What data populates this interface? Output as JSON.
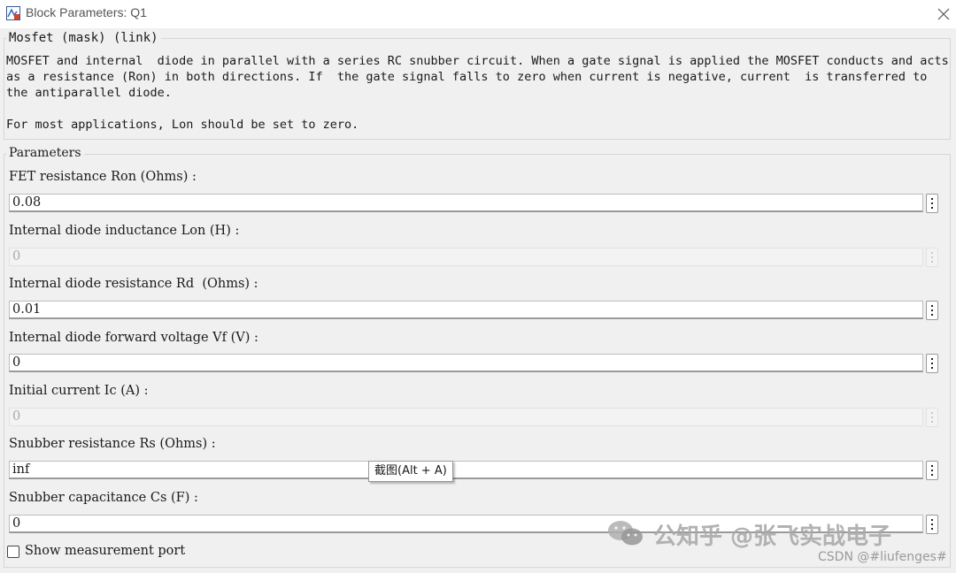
{
  "window": {
    "title": "Block Parameters: Q1"
  },
  "mask": {
    "legend": "Mosfet (mask) (link)",
    "description": "MOSFET and internal  diode in parallel with a series RC snubber circuit. When a gate signal is applied the MOSFET conducts and acts\nas a resistance (Ron) in both directions. If  the gate signal falls to zero when current is negative, current  is transferred to\nthe antiparallel diode.\n\nFor most applications, Lon should be set to zero."
  },
  "parameters": {
    "legend": "Parameters",
    "fields": [
      {
        "label": "FET resistance Ron (Ohms) :",
        "value": "0.08",
        "enabled": true
      },
      {
        "label": "Internal diode inductance Lon (H) :",
        "value": "0",
        "enabled": false
      },
      {
        "label": "Internal diode resistance Rd  (Ohms) :",
        "value": "0.01",
        "enabled": true
      },
      {
        "label": "Internal diode forward voltage Vf (V) :",
        "value": "0",
        "enabled": true
      },
      {
        "label": "Initial current Ic (A) :",
        "value": "0",
        "enabled": false
      },
      {
        "label": "Snubber resistance Rs (Ohms) :",
        "value": "inf",
        "enabled": true
      },
      {
        "label": "Snubber capacitance Cs (F) :",
        "value": "0",
        "enabled": true
      }
    ],
    "checkbox": {
      "label": "Show measurement port",
      "checked": false
    }
  },
  "tooltip": {
    "text": "截图(Alt + A)"
  },
  "watermark": {
    "main": "公知乎 @张飞实战电子",
    "csdn": "CSDN @#liufenges#"
  },
  "icons": {
    "app": "simulink-block-icon",
    "close": "close-icon",
    "more": "more-vertical-icon"
  }
}
